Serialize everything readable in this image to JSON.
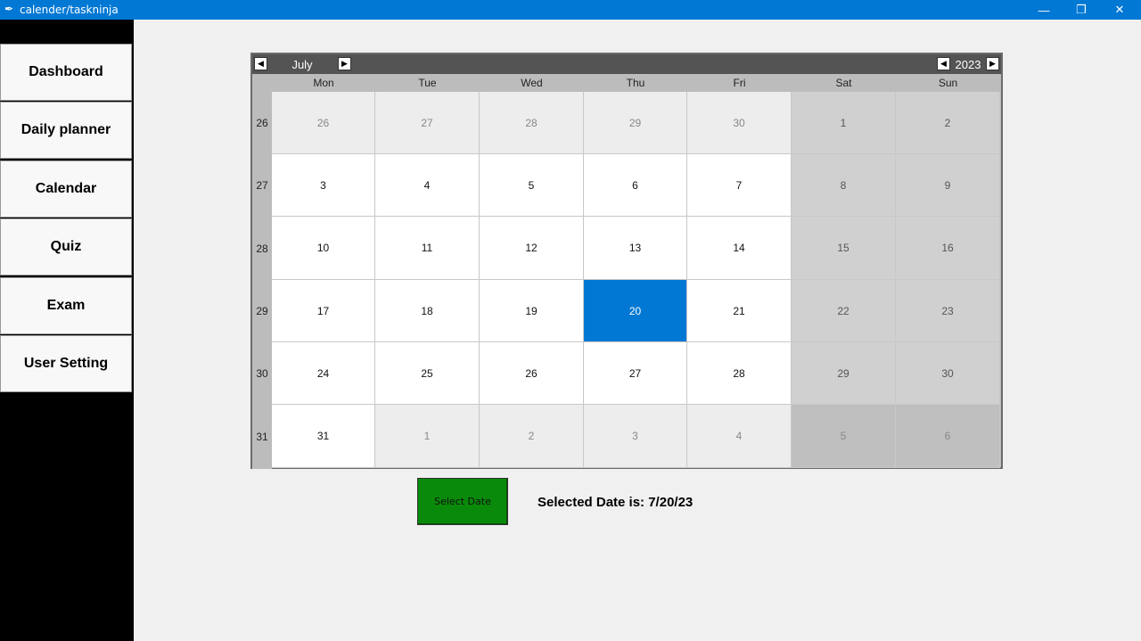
{
  "window": {
    "title": "calender/taskninja",
    "app_icon": "quill-icon",
    "controls": {
      "minimize": "—",
      "maximize": "❐",
      "close": "✕"
    }
  },
  "sidebar": {
    "items": [
      {
        "label": "Dashboard"
      },
      {
        "label": "Daily planner"
      },
      {
        "label": "Calendar"
      },
      {
        "label": "Quiz"
      },
      {
        "label": "Exam"
      },
      {
        "label": "User Setting"
      }
    ]
  },
  "calendar": {
    "month": "July",
    "year": "2023",
    "prev_month": "◀",
    "next_month": "▶",
    "prev_year": "◀",
    "next_year": "▶",
    "weekdays": [
      "Mon",
      "Tue",
      "Wed",
      "Thu",
      "Fri",
      "Sat",
      "Sun"
    ],
    "weeks": [
      {
        "num": "26",
        "days": [
          "26",
          "27",
          "28",
          "29",
          "30",
          "1",
          "2"
        ],
        "types": [
          "other",
          "other",
          "other",
          "other",
          "other",
          "weekend",
          "weekend"
        ]
      },
      {
        "num": "27",
        "days": [
          "3",
          "4",
          "5",
          "6",
          "7",
          "8",
          "9"
        ],
        "types": [
          "cur",
          "cur",
          "cur",
          "cur",
          "cur",
          "weekend",
          "weekend"
        ]
      },
      {
        "num": "28",
        "days": [
          "10",
          "11",
          "12",
          "13",
          "14",
          "15",
          "16"
        ],
        "types": [
          "cur",
          "cur",
          "cur",
          "cur",
          "cur",
          "weekend",
          "weekend"
        ]
      },
      {
        "num": "29",
        "days": [
          "17",
          "18",
          "19",
          "20",
          "21",
          "22",
          "23"
        ],
        "types": [
          "cur",
          "cur",
          "cur",
          "selected",
          "cur",
          "weekend",
          "weekend"
        ]
      },
      {
        "num": "30",
        "days": [
          "24",
          "25",
          "26",
          "27",
          "28",
          "29",
          "30"
        ],
        "types": [
          "cur",
          "cur",
          "cur",
          "cur",
          "cur",
          "weekend",
          "weekend"
        ]
      },
      {
        "num": "31",
        "days": [
          "31",
          "1",
          "2",
          "3",
          "4",
          "5",
          "6"
        ],
        "types": [
          "cur",
          "other",
          "other",
          "other",
          "other",
          "other-weekend",
          "other-weekend"
        ]
      }
    ],
    "colors": {
      "selected": "#0078d4",
      "header": "#545454"
    }
  },
  "actions": {
    "select_label": "Select Date",
    "select_color": "#0a8a0a",
    "selected_text": "Selected Date is: 7/20/23"
  }
}
